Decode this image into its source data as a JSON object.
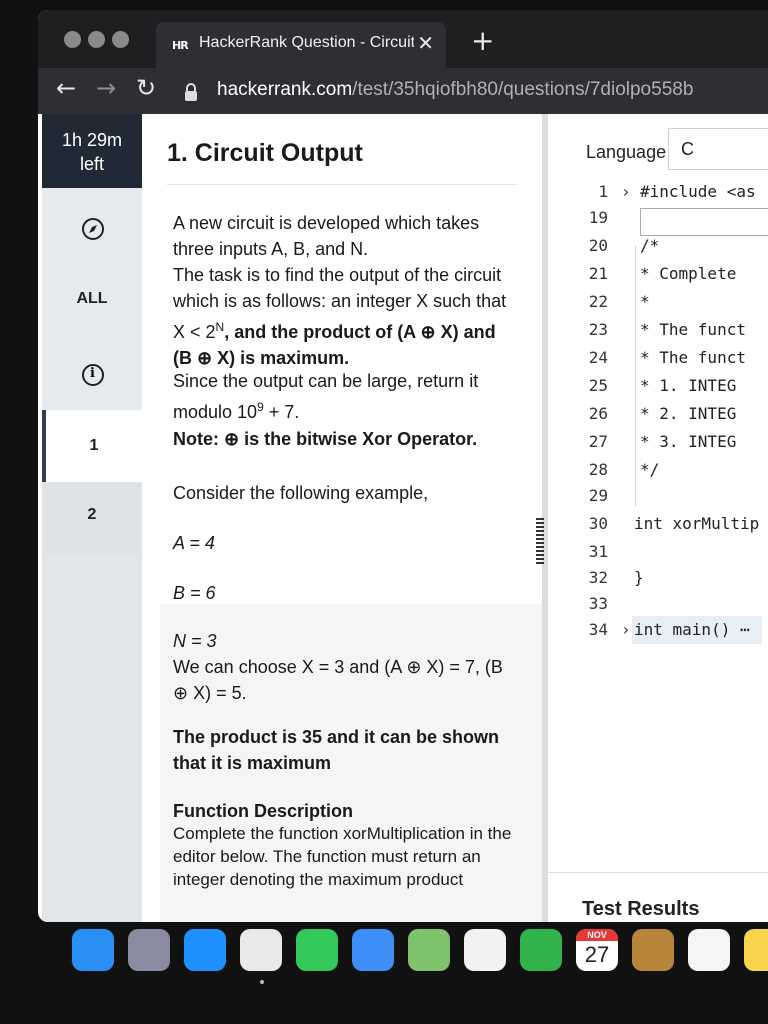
{
  "browser": {
    "tab_title": "HackerRank Question - Circuit",
    "tab_favicon": "HR",
    "url_host": "hackerrank.com",
    "url_path": "/test/35hqiofbh80/questions/7diolpo558b",
    "icons": [
      "back-arrow-icon",
      "forward-arrow-icon",
      "reload-icon",
      "lock-icon",
      "close-icon",
      "plus-icon"
    ]
  },
  "sidebar": {
    "timer_line1": "1h 29m",
    "timer_line2": "left",
    "all_label": "ALL",
    "question_numbers": [
      "1",
      "2"
    ]
  },
  "question": {
    "title": "1. Circuit Output",
    "p1": "A new circuit is developed which takes three inputs A, B, and N.",
    "p2_a": "The task is to find the output of the circuit which is as follows: an integer X such that X < 2",
    "p2_sup": "N",
    "p2_b": ", and the product of (A ⊕ X) and (B ⊕ X) is maximum.",
    "p3_a": "Since the output can be large, return it modulo 10",
    "p3_sup": "9",
    "p3_b": " + 7.",
    "note": "Note: ⊕ is the bitwise Xor Operator.",
    "example_intro": "Consider the following example,",
    "a_line": "A = 4",
    "b_line": "B = 6",
    "n_line": "N = 3",
    "choose_line": "We can choose X = 3 and (A ⊕ X) = 7, (B ⊕ X) = 5.",
    "product_line": "The product is 35 and it can be shown that it is maximum",
    "fd_heading": "Function Description",
    "fd_text": "Complete the function xorMultiplication in the editor below. The function must return an integer denoting the maximum product"
  },
  "editor": {
    "language_label": "Language",
    "language_value": "C",
    "lines": [
      {
        "n": "1",
        "text": "#include <as",
        "fold": "›"
      },
      {
        "n": "19",
        "text": "",
        "fold": ""
      },
      {
        "n": "20",
        "text": "/*",
        "fold": ""
      },
      {
        "n": "21",
        "text": " * Complete",
        "fold": ""
      },
      {
        "n": "22",
        "text": " *",
        "fold": ""
      },
      {
        "n": "23",
        "text": " * The funct",
        "fold": ""
      },
      {
        "n": "24",
        "text": " * The funct",
        "fold": ""
      },
      {
        "n": "25",
        "text": " *  1. INTEG",
        "fold": ""
      },
      {
        "n": "26",
        "text": " *  2. INTEG",
        "fold": ""
      },
      {
        "n": "27",
        "text": " *  3. INTEG",
        "fold": ""
      },
      {
        "n": "28",
        "text": " */",
        "fold": ""
      },
      {
        "n": "29",
        "text": "",
        "fold": ""
      },
      {
        "n": "30",
        "text": "int xorMultip",
        "fold": ""
      },
      {
        "n": "31",
        "text": "",
        "fold": ""
      },
      {
        "n": "32",
        "text": "}",
        "fold": ""
      },
      {
        "n": "33",
        "text": "",
        "fold": ""
      },
      {
        "n": "34",
        "text": "int main() ⋯",
        "fold": "›"
      }
    ],
    "test_results_label": "Test Results"
  },
  "dock": {
    "calendar_month": "NOV",
    "calendar_day": "27",
    "apps": [
      {
        "name": "finder-icon",
        "color": "#2a8ef2"
      },
      {
        "name": "launchpad-icon",
        "color": "#8a8aa0"
      },
      {
        "name": "safari-icon",
        "color": "#1e90ff"
      },
      {
        "name": "chrome-icon",
        "color": "#e9e9e9"
      },
      {
        "name": "messages-icon",
        "color": "#34c759"
      },
      {
        "name": "mail-icon",
        "color": "#3e8ef7"
      },
      {
        "name": "maps-icon",
        "color": "#7ec36b"
      },
      {
        "name": "photos-icon",
        "color": "#f2f2f2"
      },
      {
        "name": "facetime-icon",
        "color": "#2fb34a"
      },
      {
        "name": "calendar-icon",
        "color": "#ffffff"
      },
      {
        "name": "contacts-icon",
        "color": "#b8863b"
      },
      {
        "name": "reminders-icon",
        "color": "#f5f5f5"
      },
      {
        "name": "notes-icon",
        "color": "#f8d44c"
      }
    ]
  }
}
